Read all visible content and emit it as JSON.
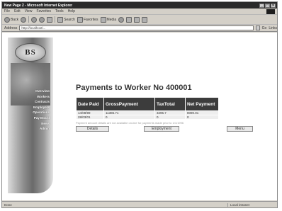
{
  "window": {
    "title": "New Page 2 - Microsoft Internet Explorer",
    "controls": [
      "_",
      "□",
      "×"
    ]
  },
  "menu": [
    "File",
    "Edit",
    "View",
    "Favorites",
    "Tools",
    "Help"
  ],
  "toolbar": {
    "back": "Back",
    "search": "Search",
    "favorites": "Favorites",
    "media": "Media"
  },
  "address": {
    "label": "Address",
    "url": "http://localhost/...",
    "go": "Go",
    "links": "Links"
  },
  "logo_text": "BS",
  "nav": [
    "Overview",
    "Workers",
    "Contracts",
    "Employers",
    "Operations",
    "Pay Board",
    "News",
    "Admin"
  ],
  "page": {
    "heading": "Payments to Worker No 400001",
    "columns": [
      "Date Paid",
      "GrossPayment",
      "TaxTotal",
      "Net Payment"
    ],
    "rows": [
      [
        "14/08/99",
        "11386.71",
        "3295.7",
        "8090.01"
      ],
      [
        "28/03/01",
        "0",
        "0",
        "0"
      ]
    ],
    "note": "Payment amount details are not available on-line for payments made prior to 1/1/1996",
    "buttons": {
      "details": "Details",
      "employment": "Employment",
      "menu": "Menu"
    }
  },
  "status": {
    "left": "Done",
    "zone": "Local intranet"
  }
}
